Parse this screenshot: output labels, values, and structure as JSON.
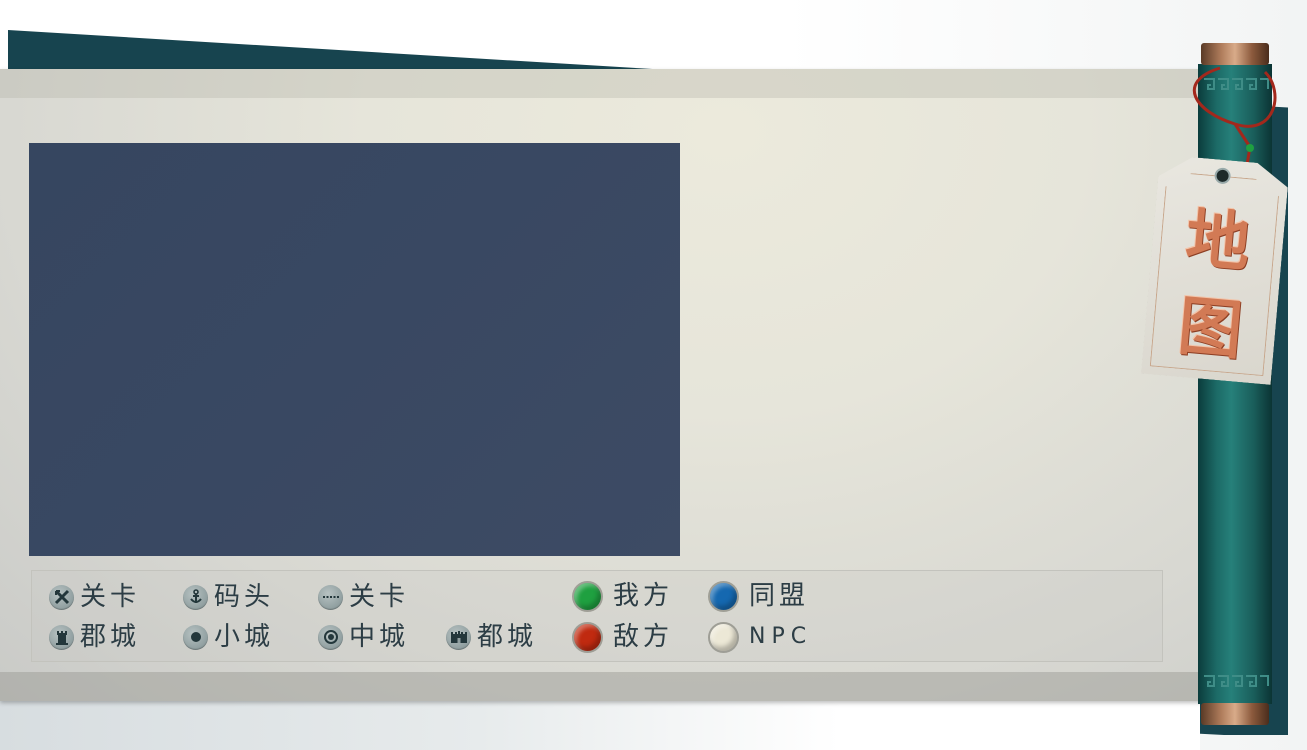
{
  "map_panel": {
    "title_chars": [
      "地",
      "图"
    ]
  },
  "legend": {
    "row1": [
      {
        "icon": "crossed-swords-icon",
        "label": "关卡"
      },
      {
        "icon": "anchor-icon",
        "label": "码头"
      },
      {
        "icon": "dashed-line-icon",
        "label": "关卡"
      }
    ],
    "row2": [
      {
        "icon": "tower-icon",
        "label": "郡城"
      },
      {
        "icon": "small-dot-icon",
        "label": "小城"
      },
      {
        "icon": "ring-dot-icon",
        "label": "中城"
      },
      {
        "icon": "castle-wall-icon",
        "label": "都城"
      }
    ],
    "factions": [
      {
        "label": "我方",
        "color": "#1fa040"
      },
      {
        "label": "同盟",
        "color": "#1568b0"
      },
      {
        "label": "敌方",
        "color": "#c02a10"
      },
      {
        "label": "NPC",
        "color": "#ece8d6"
      }
    ]
  },
  "colors": {
    "backboard": "#17444f",
    "map_bg": "#394862",
    "rod": "#1c6a66",
    "tag_text": "#d27a55"
  }
}
